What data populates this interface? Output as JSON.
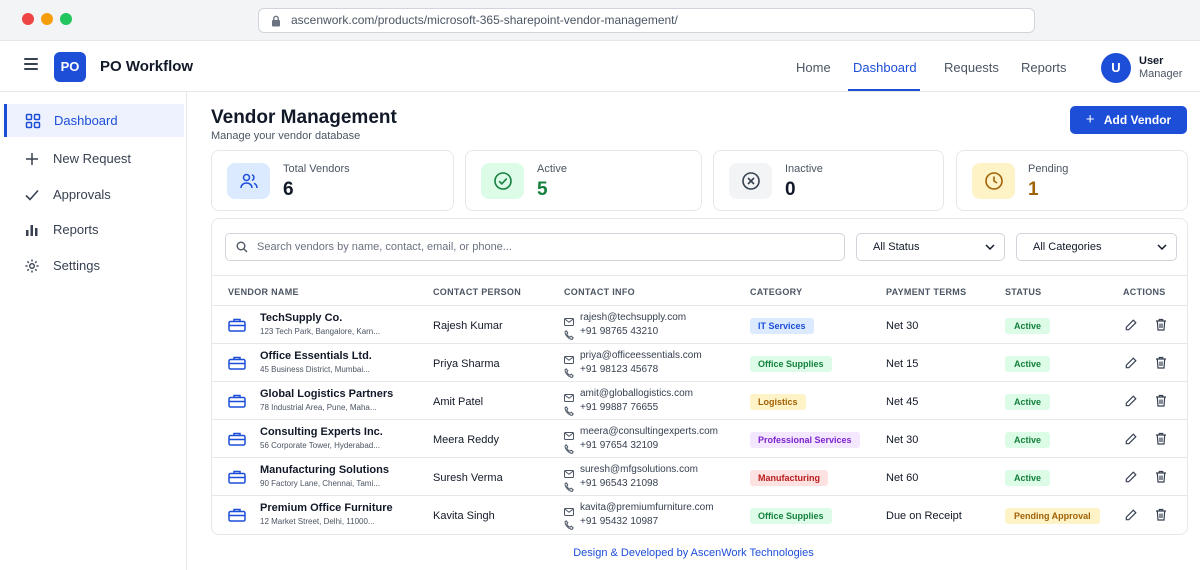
{
  "browser": {
    "url": "ascenwork.com/products/microsoft-365-sharepoint-vendor-management/"
  },
  "header": {
    "logo_text": "PO",
    "app_title": "PO Workflow",
    "nav": [
      "Home",
      "Dashboard",
      "Requests",
      "Reports"
    ],
    "active_nav": "Dashboard",
    "user_initial": "U",
    "user_name": "User",
    "user_role": "Manager"
  },
  "sidebar": {
    "items": [
      {
        "label": "Dashboard",
        "icon": "grid-icon",
        "active": true
      },
      {
        "label": "New Request",
        "icon": "plus-icon",
        "active": false
      },
      {
        "label": "Approvals",
        "icon": "check-icon",
        "active": false
      },
      {
        "label": "Reports",
        "icon": "bar-chart-icon",
        "active": false
      },
      {
        "label": "Settings",
        "icon": "gear-icon",
        "active": false
      }
    ]
  },
  "main": {
    "title": "Vendor Management",
    "subtitle": "Manage your vendor database",
    "add_button": "Add Vendor",
    "stats": [
      {
        "label": "Total Vendors",
        "value": "6",
        "icon": "users-icon",
        "color": "#1d4ed8",
        "bg": "#dbeafe",
        "value_color": "#111827"
      },
      {
        "label": "Active",
        "value": "5",
        "icon": "check-circle-icon",
        "color": "#15803d",
        "bg": "#dcfce7",
        "value_color": "#15803d"
      },
      {
        "label": "Inactive",
        "value": "0",
        "icon": "x-circle-icon",
        "color": "#374151",
        "bg": "#f3f4f6",
        "value_color": "#111827"
      },
      {
        "label": "Pending",
        "value": "1",
        "icon": "clock-icon",
        "color": "#a16207",
        "bg": "#fef3c7",
        "value_color": "#a16207"
      }
    ],
    "search_placeholder": "Search vendors by name, contact, email, or phone...",
    "status_filter": "All Status",
    "category_filter": "All Categories",
    "columns": [
      "VENDOR NAME",
      "CONTACT PERSON",
      "CONTACT INFO",
      "CATEGORY",
      "PAYMENT TERMS",
      "STATUS",
      "ACTIONS"
    ],
    "vendors": [
      {
        "name": "TechSupply Co.",
        "address": "123 Tech Park, Bangalore, Karn...",
        "contact": "Rajesh Kumar",
        "email": "rajesh@techsupply.com",
        "phone": "+91 98765 43210",
        "category": "IT Services",
        "cat_fg": "#1d4ed8",
        "cat_bg": "#dbeafe",
        "terms": "Net 30",
        "status": "Active",
        "st_fg": "#15803d",
        "st_bg": "#dcfce7"
      },
      {
        "name": "Office Essentials Ltd.",
        "address": "45 Business District, Mumbai...",
        "contact": "Priya Sharma",
        "email": "priya@officeessentials.com",
        "phone": "+91 98123 45678",
        "category": "Office Supplies",
        "cat_fg": "#15803d",
        "cat_bg": "#dcfce7",
        "terms": "Net 15",
        "status": "Active",
        "st_fg": "#15803d",
        "st_bg": "#dcfce7"
      },
      {
        "name": "Global Logistics Partners",
        "address": "78 Industrial Area, Pune, Maha...",
        "contact": "Amit Patel",
        "email": "amit@globallogistics.com",
        "phone": "+91 99887 76655",
        "category": "Logistics",
        "cat_fg": "#a16207",
        "cat_bg": "#fef3c7",
        "terms": "Net 45",
        "status": "Active",
        "st_fg": "#15803d",
        "st_bg": "#dcfce7"
      },
      {
        "name": "Consulting Experts Inc.",
        "address": "56 Corporate Tower, Hyderabad...",
        "contact": "Meera Reddy",
        "email": "meera@consultingexperts.com",
        "phone": "+91 97654 32109",
        "category": "Professional Services",
        "cat_fg": "#7e22ce",
        "cat_bg": "#f3e8ff",
        "terms": "Net 30",
        "status": "Active",
        "st_fg": "#15803d",
        "st_bg": "#dcfce7"
      },
      {
        "name": "Manufacturing Solutions",
        "address": "90 Factory Lane, Chennai, Tami...",
        "contact": "Suresh Verma",
        "email": "suresh@mfgsolutions.com",
        "phone": "+91 96543 21098",
        "category": "Manufacturing",
        "cat_fg": "#b91c1c",
        "cat_bg": "#fee2e2",
        "terms": "Net 60",
        "status": "Active",
        "st_fg": "#15803d",
        "st_bg": "#dcfce7"
      },
      {
        "name": "Premium Office Furniture",
        "address": "12 Market Street, Delhi, 11000...",
        "contact": "Kavita Singh",
        "email": "kavita@premiumfurniture.com",
        "phone": "+91 95432 10987",
        "category": "Office Supplies",
        "cat_fg": "#15803d",
        "cat_bg": "#dcfce7",
        "terms": "Due on Receipt",
        "status": "Pending Approval",
        "st_fg": "#a16207",
        "st_bg": "#fef3c7"
      }
    ]
  },
  "footer": "Design & Developed by AscenWork Technologies"
}
